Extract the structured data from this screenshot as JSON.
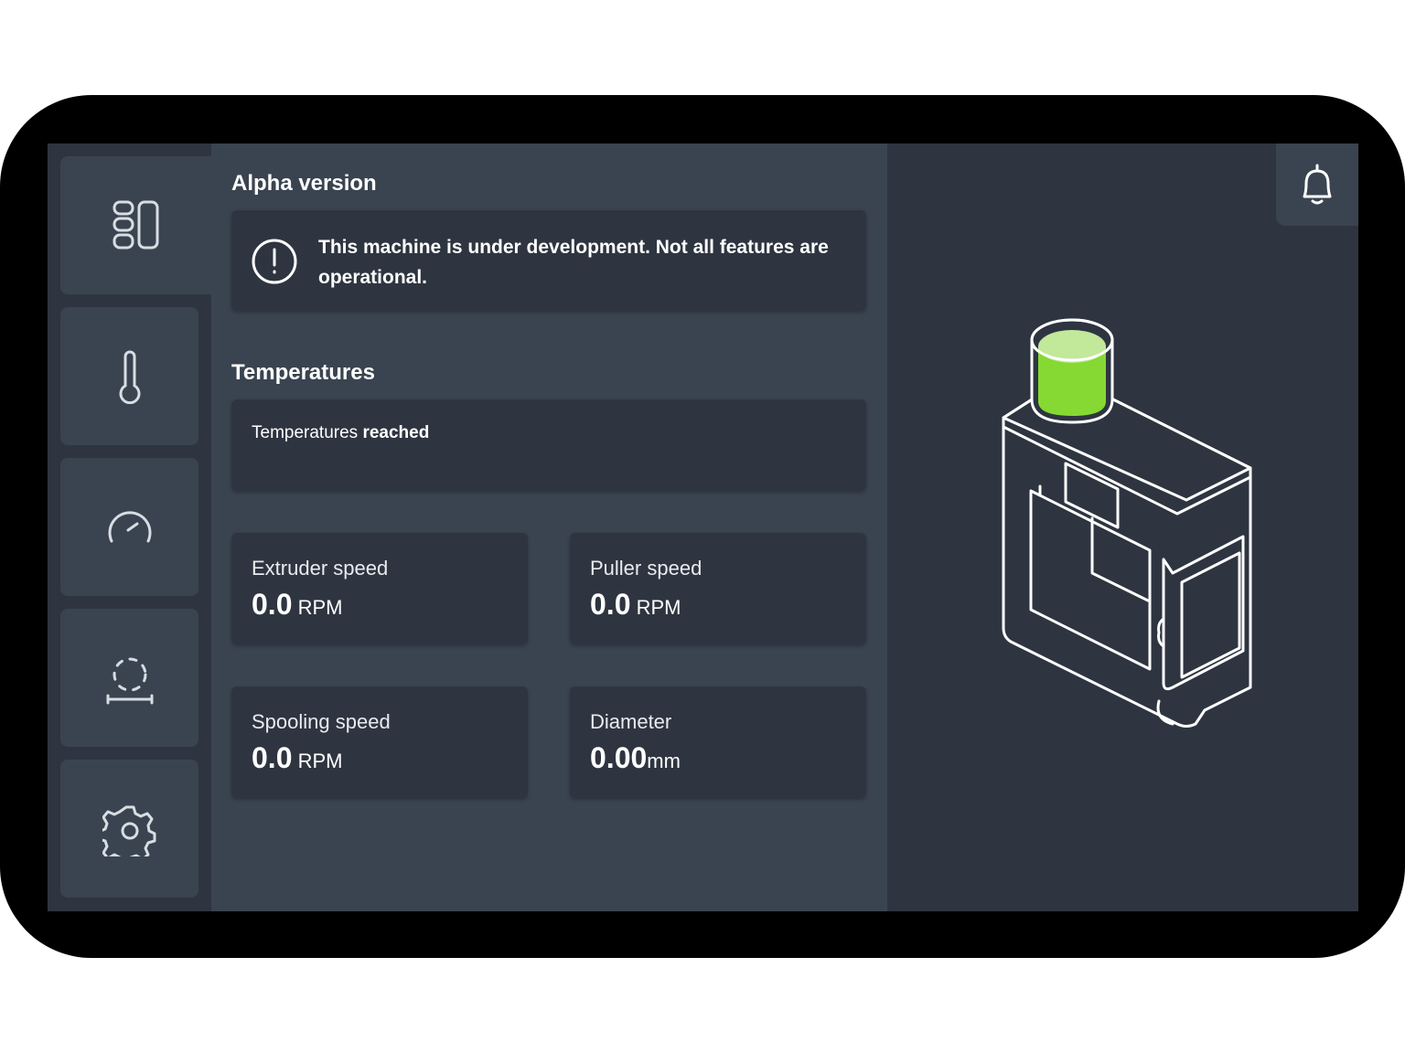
{
  "nav": {
    "items": [
      {
        "icon": "dashboard-icon",
        "active": true
      },
      {
        "icon": "thermometer-icon",
        "active": false
      },
      {
        "icon": "speedometer-icon",
        "active": false
      },
      {
        "icon": "measure-icon",
        "active": false
      },
      {
        "icon": "gear-icon",
        "active": false
      }
    ]
  },
  "alert": {
    "title": "Alpha version",
    "message": "This machine is under development. Not all features are operational."
  },
  "temperatures": {
    "title": "Temperatures",
    "status_prefix": "Temperatures",
    "status_value": "reached"
  },
  "stats": [
    {
      "label": "Extruder speed",
      "value": "0.0",
      "unit": " RPM"
    },
    {
      "label": "Puller speed",
      "value": "0.0",
      "unit": " RPM"
    },
    {
      "label": "Spooling speed",
      "value": "0.0",
      "unit": " RPM"
    },
    {
      "label": "Diameter",
      "value": "0.00",
      "unit": "mm"
    }
  ],
  "header": {
    "notification_icon": "bell-icon"
  },
  "colors": {
    "accent_green": "#86d932",
    "accent_green_light": "#c2e89a"
  },
  "machine": {
    "hopper_fill": "green"
  }
}
